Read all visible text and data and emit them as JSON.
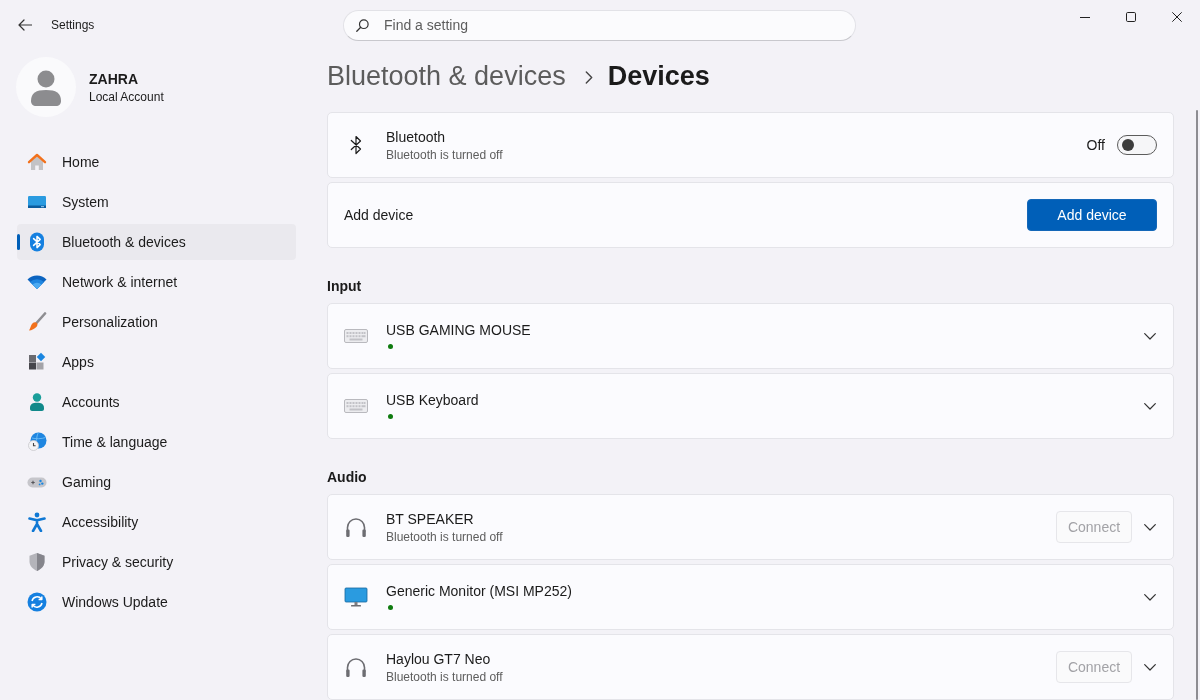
{
  "window": {
    "title": "Settings"
  },
  "search": {
    "placeholder": "Find a setting"
  },
  "account": {
    "name": "ZAHRA",
    "type": "Local Account"
  },
  "sidebar": {
    "items": [
      {
        "label": "Home",
        "selected": false
      },
      {
        "label": "System",
        "selected": false
      },
      {
        "label": "Bluetooth & devices",
        "selected": true
      },
      {
        "label": "Network & internet",
        "selected": false
      },
      {
        "label": "Personalization",
        "selected": false
      },
      {
        "label": "Apps",
        "selected": false
      },
      {
        "label": "Accounts",
        "selected": false
      },
      {
        "label": "Time & language",
        "selected": false
      },
      {
        "label": "Gaming",
        "selected": false
      },
      {
        "label": "Accessibility",
        "selected": false
      },
      {
        "label": "Privacy & security",
        "selected": false
      },
      {
        "label": "Windows Update",
        "selected": false
      }
    ]
  },
  "breadcrumb": {
    "parent": "Bluetooth & devices",
    "current": "Devices"
  },
  "bluetooth": {
    "title": "Bluetooth",
    "status": "Bluetooth is turned off",
    "state_label": "Off",
    "on": false
  },
  "add_device": {
    "label": "Add device",
    "button": "Add device"
  },
  "sections": [
    {
      "title": "Input",
      "devices": [
        {
          "kind": "keyboard",
          "name": "USB GAMING MOUSE",
          "connected": true,
          "expanded": false
        },
        {
          "kind": "keyboard",
          "name": "USB Keyboard",
          "connected": true,
          "expanded": false
        }
      ]
    },
    {
      "title": "Audio",
      "devices": [
        {
          "kind": "headset",
          "name": "BT SPEAKER",
          "status": "Bluetooth is turned off",
          "connected": false,
          "action": {
            "label": "Connect",
            "disabled": true
          },
          "expanded": false
        },
        {
          "kind": "monitor",
          "name": "Generic Monitor (MSI MP252)",
          "connected": true,
          "expanded": false
        },
        {
          "kind": "headset",
          "name": "Haylou GT7 Neo",
          "status": "Bluetooth is turned off",
          "connected": false,
          "action": {
            "label": "Connect",
            "disabled": true
          },
          "expanded": false
        }
      ]
    }
  ]
}
